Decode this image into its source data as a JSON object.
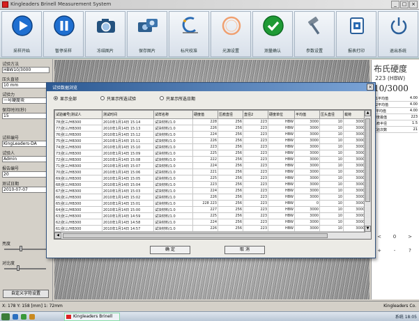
{
  "window": {
    "title": "Kingleaders Brinell Measurement System",
    "controls": [
      "_",
      "□",
      "×"
    ]
  },
  "toolbar": {
    "buttons": [
      {
        "label": "采样开始",
        "icon": "play-icon"
      },
      {
        "label": "暂停采样",
        "icon": "pause-icon"
      },
      {
        "label": "冻结图片",
        "icon": "camera-icon"
      },
      {
        "label": "保存图片",
        "icon": "save-image-icon"
      },
      {
        "label": "标尺校准",
        "icon": "calibrate-icon"
      },
      {
        "label": "光源设置",
        "icon": "ring-light-icon"
      },
      {
        "label": "测量确认",
        "icon": "confirm-icon"
      },
      {
        "label": "参数设置",
        "icon": "hammer-icon"
      },
      {
        "label": "报表打印",
        "icon": "report-icon"
      },
      {
        "label": "退出系统",
        "icon": "power-icon"
      }
    ]
  },
  "left_panel": {
    "label1": "试验方法",
    "field1": "HBW10/3000",
    "label2": "压头直径",
    "field2": "10 mm",
    "label3": "试验力",
    "field3": "一号硬度块",
    "label4": "保持时间(秒)",
    "field4": "15",
    "label5": "试样编号",
    "field5": "KingLeaders-DA",
    "label6": "试验人",
    "field6": "Admin",
    "label7": "报告编号",
    "field7": "20",
    "label8": "测试日期",
    "field8": "2010-07-07",
    "slider1_label": "亮度",
    "slider2_label": "对比度",
    "bottom_button": "自定义字符设置"
  },
  "right_panel": {
    "title": "布氏硬度",
    "sub": "223 (HBW)",
    "value": "10/3000",
    "rows": [
      {
        "k": "D1平均值",
        "v": "4.00"
      },
      {
        "k": "D2平均值",
        "v": "4.00"
      },
      {
        "k": "D平均值",
        "v": "4.00"
      },
      {
        "k": "硬度最值",
        "v": "223"
      },
      {
        "k": "压痕半径",
        "v": "1.5"
      },
      {
        "k": "试验次数",
        "v": "21"
      }
    ],
    "nav": [
      "<",
      "0",
      ">",
      "+",
      "-",
      "?"
    ]
  },
  "status": {
    "left": "X: 178 Y: 158  [mm]  1: 72mm",
    "right": "Kingleaders Co."
  },
  "taskbar": {
    "task": "Kingleaders Brinell",
    "tray": "系统 18:05"
  },
  "dialog": {
    "title": "试验数据浏览",
    "close": "×",
    "radios": [
      "显示全部",
      "只显示所选试验",
      "只显示所选日期"
    ],
    "columns": [
      "试验编号|测试人",
      "测试时间",
      "试样名称",
      "硬度值",
      "压痕直径",
      "直径2",
      "硬度单位",
      "平均值",
      "压头直径",
      "载荷"
    ],
    "rows": [
      [
        "78|张三/HB300",
        "2010年1月14日 15:14",
        "试块材料/1.0",
        "228",
        "256",
        "223",
        "HBW",
        "3000",
        "10",
        "3000"
      ],
      [
        "77|张三/HB300",
        "2010年1月14日 15:13",
        "试块材料/1.0",
        "226",
        "256",
        "223",
        "HBW",
        "3000",
        "10",
        "3000"
      ],
      [
        "76|张三/HB300",
        "2010年1月14日 15:12",
        "试块材料/1.0",
        "224",
        "256",
        "223",
        "HBW",
        "3000",
        "10",
        "3000"
      ],
      [
        "75|张三/HB300",
        "2010年1月14日 15:11",
        "试块材料/1.0",
        "226",
        "256",
        "223",
        "HBW",
        "3000",
        "10",
        "3000"
      ],
      [
        "74|张三/HB300",
        "2010年1月14日 15:10",
        "试块材料/1.0",
        "223",
        "256",
        "223",
        "HBW",
        "3000",
        "10",
        "3000"
      ],
      [
        "73|张三/HB300",
        "2010年1月14日 15:09",
        "试块材料/1.0",
        "225",
        "256",
        "223",
        "HBW",
        "3000",
        "10",
        "3000"
      ],
      [
        "72|张三/HB300",
        "2010年1月14日 15:08",
        "试块材料/1.0",
        "222",
        "256",
        "223",
        "HBW",
        "3000",
        "10",
        "3000"
      ],
      [
        "71|张三/HB300",
        "2010年1月14日 15:07",
        "试块材料/1.0",
        "224",
        "256",
        "223",
        "HBW",
        "3000",
        "10",
        "3000"
      ],
      [
        "70|张三/HB300",
        "2010年1月14日 15:06",
        "试块材料/1.0",
        "221",
        "256",
        "223",
        "HBW",
        "3000",
        "10",
        "3000"
      ],
      [
        "69|张三/HB300",
        "2010年1月14日 15:05",
        "试块材料/1.0",
        "225",
        "256",
        "223",
        "HBW",
        "3000",
        "10",
        "3000"
      ],
      [
        "68|张三/HB300",
        "2010年1月14日 15:04",
        "试块材料/1.0",
        "223",
        "256",
        "223",
        "HBW",
        "3000",
        "10",
        "3000"
      ],
      [
        "67|张三/HB300",
        "2010年1月14日 15:03",
        "试块材料/1.0",
        "224",
        "256",
        "223",
        "HBW",
        "3000",
        "10",
        "3000"
      ],
      [
        "66|张三/HB300",
        "2010年1月14日 15:02",
        "试块材料/1.0",
        "226",
        "256",
        "223",
        "HBW",
        "3000",
        "10",
        "3000"
      ],
      [
        "65|张三/HB300",
        "2010年1月14日 15:01",
        "试块材料/1.0",
        "228 223",
        "256",
        "223",
        "HBW",
        "0",
        "10",
        "3000"
      ],
      [
        "64|张三/HB300",
        "2010年1月14日 15:00",
        "试块材料/1.0",
        "227",
        "256",
        "223",
        "HBW",
        "3000",
        "10",
        "3000"
      ],
      [
        "63|张三/HB300",
        "2010年1月14日 14:59",
        "试块材料/1.0",
        "225",
        "256",
        "223",
        "HBW",
        "3000",
        "10",
        "3000"
      ],
      [
        "62|张三/HB300",
        "2010年1月14日 14:58",
        "试块材料/1.0",
        "224",
        "256",
        "223",
        "HBW",
        "3000",
        "10",
        "3000"
      ],
      [
        "61|张三/HB300",
        "2010年1月14日 14:57",
        "试块材料/1.0",
        "226",
        "256",
        "223",
        "HBW",
        "3000",
        "10",
        "3000"
      ]
    ],
    "btn_ok": "确  定",
    "btn_cancel": "取  消"
  }
}
